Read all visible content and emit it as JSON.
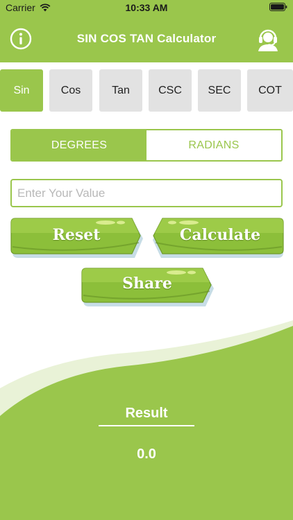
{
  "status_bar": {
    "carrier": "Carrier",
    "time": "10:33 AM"
  },
  "nav": {
    "title": "SIN COS TAN Calculator",
    "left_icon": "info-icon",
    "right_icon": "support-headset-icon"
  },
  "functions": [
    {
      "label": "Sin",
      "active": true
    },
    {
      "label": "Cos",
      "active": false
    },
    {
      "label": "Tan",
      "active": false
    },
    {
      "label": "CSC",
      "active": false
    },
    {
      "label": "SEC",
      "active": false
    },
    {
      "label": "COT",
      "active": false
    }
  ],
  "mode": {
    "degrees": "DEGREES",
    "radians": "RADIANS",
    "selected": "DEGREES"
  },
  "input": {
    "placeholder": "Enter Your Value",
    "value": ""
  },
  "buttons": {
    "reset": "Reset",
    "calculate": "Calculate",
    "share": "Share"
  },
  "result": {
    "label": "Result",
    "value": "0.0"
  },
  "colors": {
    "primary_green": "#9ac64c",
    "button_green": "#8cbf3a",
    "inactive_tab": "#e2e2e2"
  }
}
